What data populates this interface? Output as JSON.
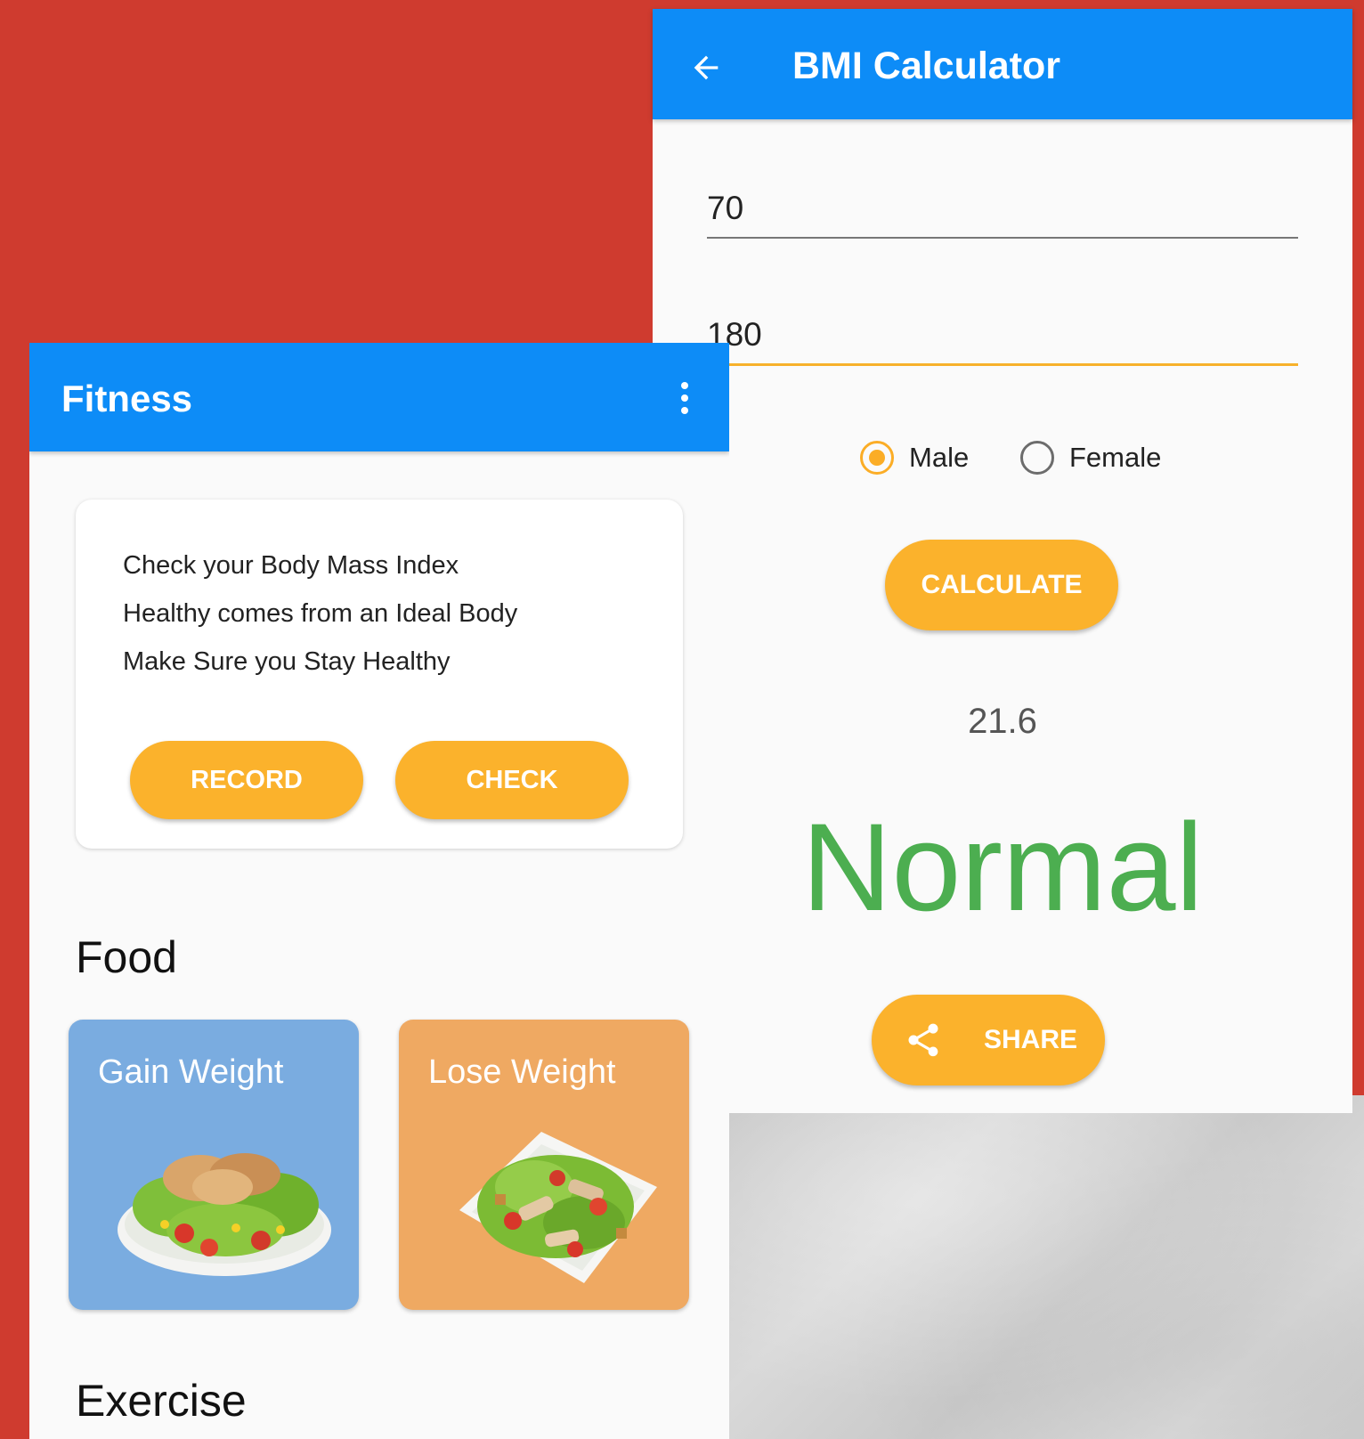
{
  "bmi_screen": {
    "title": "BMI Calculator",
    "weight_value": "70",
    "height_value": "180",
    "gender_options": [
      {
        "label": "Male",
        "selected": true
      },
      {
        "label": "Female",
        "selected": false
      }
    ],
    "calculate_label": "CALCULATE",
    "result_value": "21.6",
    "result_status": "Normal",
    "share_label": "SHARE"
  },
  "fitness_screen": {
    "title": "Fitness",
    "card_lines": [
      "Check your Body Mass Index",
      "Healthy comes from an Ideal Body",
      "Make Sure you Stay Healthy"
    ],
    "record_label": "RECORD",
    "check_label": "CHECK",
    "food_title": "Food",
    "food_tiles": [
      {
        "label": "Gain Weight"
      },
      {
        "label": "Lose Weight"
      }
    ],
    "exercise_title": "Exercise"
  },
  "colors": {
    "background": "#cf3b2f",
    "app_bar": "#0d8cf7",
    "accent": "#fbb22c",
    "status_normal": "#4cae50",
    "gain_tile": "#7aace0",
    "lose_tile": "#efa962"
  },
  "icons": {
    "back": "arrow-left-icon",
    "more": "more-vert-icon",
    "share": "share-icon"
  }
}
